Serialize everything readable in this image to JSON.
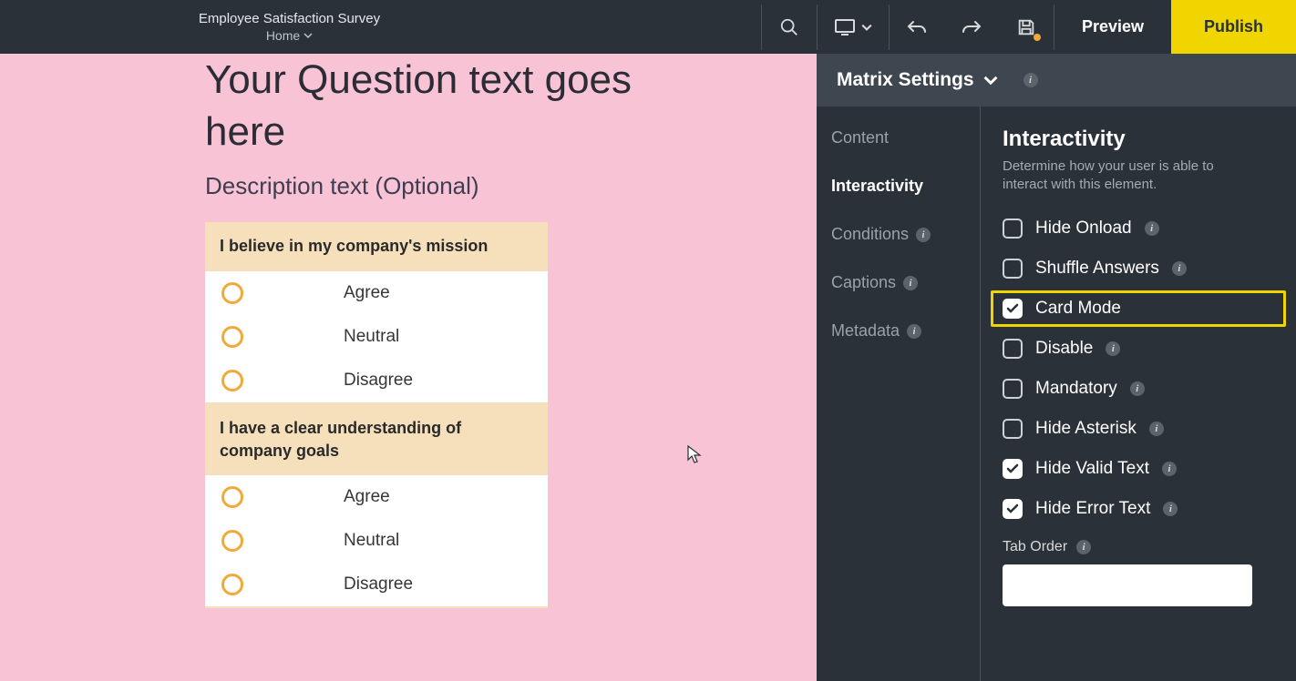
{
  "header": {
    "title": "Employee Satisfaction Survey",
    "breadcrumb": "Home",
    "preview": "Preview",
    "publish": "Publish"
  },
  "question": {
    "title": "Your Question text goes here",
    "description": "Description text (Optional)"
  },
  "matrix": {
    "rows": [
      {
        "label": "I believe in my company's mission"
      },
      {
        "label": "I have a clear understanding of company goals"
      }
    ],
    "options": [
      "Agree",
      "Neutral",
      "Disagree"
    ]
  },
  "panel": {
    "title": "Matrix Settings",
    "nav": [
      {
        "label": "Content",
        "info": false
      },
      {
        "label": "Interactivity",
        "info": false
      },
      {
        "label": "Conditions",
        "info": true
      },
      {
        "label": "Captions",
        "info": true
      },
      {
        "label": "Metadata",
        "info": true
      }
    ],
    "section": {
      "title": "Interactivity",
      "sub": "Determine how your user is able to interact with this element."
    },
    "checks": [
      {
        "label": "Hide Onload",
        "checked": false,
        "info": true,
        "highlight": false
      },
      {
        "label": "Shuffle Answers",
        "checked": false,
        "info": true,
        "highlight": false
      },
      {
        "label": "Card Mode",
        "checked": true,
        "info": false,
        "highlight": true
      },
      {
        "label": "Disable",
        "checked": false,
        "info": true,
        "highlight": false
      },
      {
        "label": "Mandatory",
        "checked": false,
        "info": true,
        "highlight": false
      },
      {
        "label": "Hide Asterisk",
        "checked": false,
        "info": true,
        "highlight": false
      },
      {
        "label": "Hide Valid Text",
        "checked": true,
        "info": true,
        "highlight": false
      },
      {
        "label": "Hide Error Text",
        "checked": true,
        "info": true,
        "highlight": false
      }
    ],
    "taborder": {
      "label": "Tab Order",
      "value": ""
    }
  }
}
